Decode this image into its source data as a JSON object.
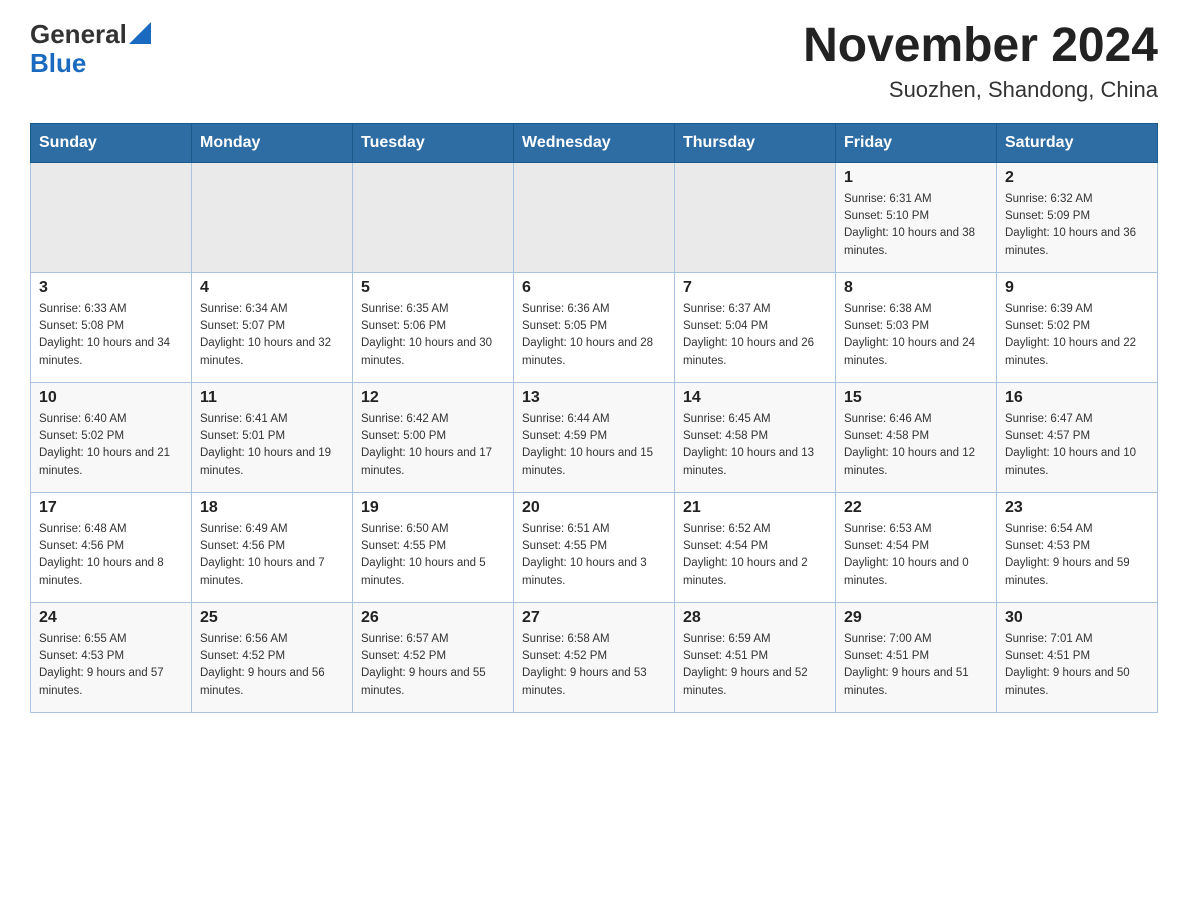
{
  "header": {
    "logo_general": "General",
    "logo_blue": "Blue",
    "month_year": "November 2024",
    "location": "Suozhen, Shandong, China"
  },
  "weekdays": [
    "Sunday",
    "Monday",
    "Tuesday",
    "Wednesday",
    "Thursday",
    "Friday",
    "Saturday"
  ],
  "weeks": [
    {
      "days": [
        {
          "number": "",
          "info": ""
        },
        {
          "number": "",
          "info": ""
        },
        {
          "number": "",
          "info": ""
        },
        {
          "number": "",
          "info": ""
        },
        {
          "number": "",
          "info": ""
        },
        {
          "number": "1",
          "info": "Sunrise: 6:31 AM\nSunset: 5:10 PM\nDaylight: 10 hours and 38 minutes."
        },
        {
          "number": "2",
          "info": "Sunrise: 6:32 AM\nSunset: 5:09 PM\nDaylight: 10 hours and 36 minutes."
        }
      ]
    },
    {
      "days": [
        {
          "number": "3",
          "info": "Sunrise: 6:33 AM\nSunset: 5:08 PM\nDaylight: 10 hours and 34 minutes."
        },
        {
          "number": "4",
          "info": "Sunrise: 6:34 AM\nSunset: 5:07 PM\nDaylight: 10 hours and 32 minutes."
        },
        {
          "number": "5",
          "info": "Sunrise: 6:35 AM\nSunset: 5:06 PM\nDaylight: 10 hours and 30 minutes."
        },
        {
          "number": "6",
          "info": "Sunrise: 6:36 AM\nSunset: 5:05 PM\nDaylight: 10 hours and 28 minutes."
        },
        {
          "number": "7",
          "info": "Sunrise: 6:37 AM\nSunset: 5:04 PM\nDaylight: 10 hours and 26 minutes."
        },
        {
          "number": "8",
          "info": "Sunrise: 6:38 AM\nSunset: 5:03 PM\nDaylight: 10 hours and 24 minutes."
        },
        {
          "number": "9",
          "info": "Sunrise: 6:39 AM\nSunset: 5:02 PM\nDaylight: 10 hours and 22 minutes."
        }
      ]
    },
    {
      "days": [
        {
          "number": "10",
          "info": "Sunrise: 6:40 AM\nSunset: 5:02 PM\nDaylight: 10 hours and 21 minutes."
        },
        {
          "number": "11",
          "info": "Sunrise: 6:41 AM\nSunset: 5:01 PM\nDaylight: 10 hours and 19 minutes."
        },
        {
          "number": "12",
          "info": "Sunrise: 6:42 AM\nSunset: 5:00 PM\nDaylight: 10 hours and 17 minutes."
        },
        {
          "number": "13",
          "info": "Sunrise: 6:44 AM\nSunset: 4:59 PM\nDaylight: 10 hours and 15 minutes."
        },
        {
          "number": "14",
          "info": "Sunrise: 6:45 AM\nSunset: 4:58 PM\nDaylight: 10 hours and 13 minutes."
        },
        {
          "number": "15",
          "info": "Sunrise: 6:46 AM\nSunset: 4:58 PM\nDaylight: 10 hours and 12 minutes."
        },
        {
          "number": "16",
          "info": "Sunrise: 6:47 AM\nSunset: 4:57 PM\nDaylight: 10 hours and 10 minutes."
        }
      ]
    },
    {
      "days": [
        {
          "number": "17",
          "info": "Sunrise: 6:48 AM\nSunset: 4:56 PM\nDaylight: 10 hours and 8 minutes."
        },
        {
          "number": "18",
          "info": "Sunrise: 6:49 AM\nSunset: 4:56 PM\nDaylight: 10 hours and 7 minutes."
        },
        {
          "number": "19",
          "info": "Sunrise: 6:50 AM\nSunset: 4:55 PM\nDaylight: 10 hours and 5 minutes."
        },
        {
          "number": "20",
          "info": "Sunrise: 6:51 AM\nSunset: 4:55 PM\nDaylight: 10 hours and 3 minutes."
        },
        {
          "number": "21",
          "info": "Sunrise: 6:52 AM\nSunset: 4:54 PM\nDaylight: 10 hours and 2 minutes."
        },
        {
          "number": "22",
          "info": "Sunrise: 6:53 AM\nSunset: 4:54 PM\nDaylight: 10 hours and 0 minutes."
        },
        {
          "number": "23",
          "info": "Sunrise: 6:54 AM\nSunset: 4:53 PM\nDaylight: 9 hours and 59 minutes."
        }
      ]
    },
    {
      "days": [
        {
          "number": "24",
          "info": "Sunrise: 6:55 AM\nSunset: 4:53 PM\nDaylight: 9 hours and 57 minutes."
        },
        {
          "number": "25",
          "info": "Sunrise: 6:56 AM\nSunset: 4:52 PM\nDaylight: 9 hours and 56 minutes."
        },
        {
          "number": "26",
          "info": "Sunrise: 6:57 AM\nSunset: 4:52 PM\nDaylight: 9 hours and 55 minutes."
        },
        {
          "number": "27",
          "info": "Sunrise: 6:58 AM\nSunset: 4:52 PM\nDaylight: 9 hours and 53 minutes."
        },
        {
          "number": "28",
          "info": "Sunrise: 6:59 AM\nSunset: 4:51 PM\nDaylight: 9 hours and 52 minutes."
        },
        {
          "number": "29",
          "info": "Sunrise: 7:00 AM\nSunset: 4:51 PM\nDaylight: 9 hours and 51 minutes."
        },
        {
          "number": "30",
          "info": "Sunrise: 7:01 AM\nSunset: 4:51 PM\nDaylight: 9 hours and 50 minutes."
        }
      ]
    }
  ]
}
